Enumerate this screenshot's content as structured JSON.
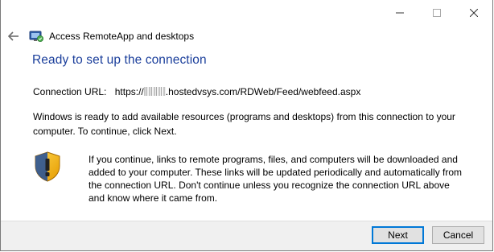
{
  "window": {
    "controls": {
      "minimize_icon": "minimize-icon",
      "maximize_icon": "maximize-icon",
      "close_icon": "close-icon"
    }
  },
  "nav": {
    "back_icon": "back-arrow-icon",
    "app_icon": "remoteapp-icon",
    "title": "Access RemoteApp and desktops"
  },
  "main": {
    "heading": "Ready to set up the connection",
    "connection_url_label": "Connection URL:",
    "connection_url_prefix": "https://",
    "connection_url_suffix": ".hostedvsys.com/RDWeb/Feed/webfeed.aspx",
    "description": "Windows is ready to add available resources (programs and desktops) from this connection to your computer. To continue, click Next.",
    "warning_icon": "shield-warning-icon",
    "warning_text": "If you continue, links to remote programs, files, and computers will be downloaded and added to your computer.  These links will be updated periodically and automatically from the connection URL. Don't continue unless you recognize the connection URL above and know where it came from."
  },
  "footer": {
    "next_label": "Next",
    "cancel_label": "Cancel"
  },
  "colors": {
    "heading": "#1a3e9b",
    "default_button_border": "#0078d7",
    "footer_background": "#f0f0f0"
  }
}
